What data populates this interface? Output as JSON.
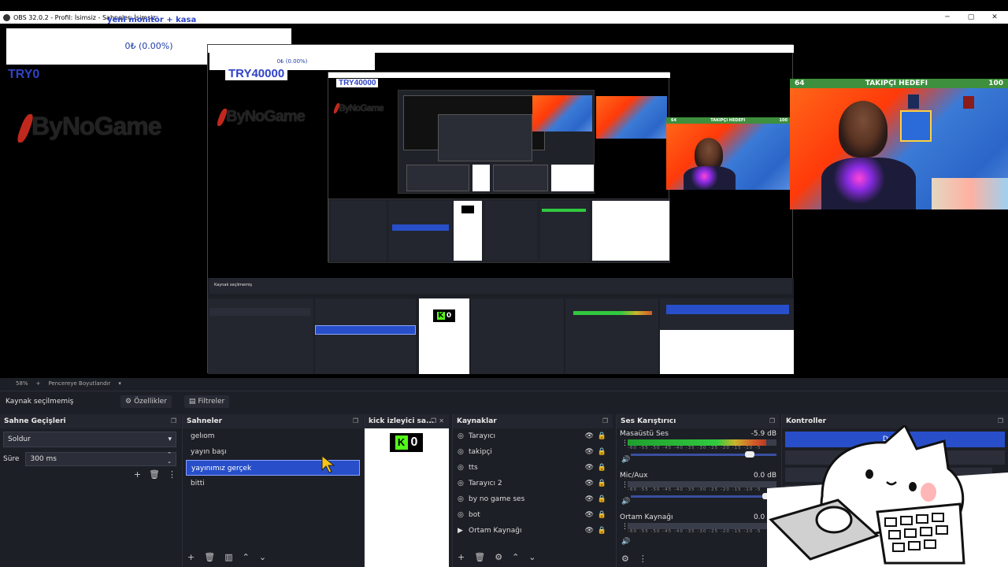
{
  "window": {
    "title": "OBS 32.0.2 - Profil: İsimsiz - Sahneler: İsimsiz",
    "overlay_text": "yeni monitör + kasa"
  },
  "preview": {
    "donation_text": "0₺ (0.00%)",
    "try_small": "TRY0",
    "try_big": "TRY40000",
    "try_mid": "TRY40000",
    "logo_text": "ByNoGame",
    "goal_label": "TAKIPÇI HEDEFI",
    "goal_current": "64",
    "goal_target": "100"
  },
  "status": {
    "zoom": "58%",
    "fit": "Pencereye Boyutlandır"
  },
  "source_bar": {
    "selected": "Kaynak seçilmemiş",
    "properties": "Özellikler",
    "filters": "Filtreler"
  },
  "transitions": {
    "title": "Sahne Geçişleri",
    "type": "Soldur",
    "duration_label": "Süre",
    "duration_value": "300 ms"
  },
  "scenes": {
    "title": "Sahneler",
    "items": [
      "gelıom",
      "yayın başı",
      "yayınımız gerçek",
      "bitti"
    ],
    "selected_index": 2
  },
  "kick": {
    "title": "kick izleyici sa...",
    "letter": "K",
    "count": "0"
  },
  "sources": {
    "title": "Kaynaklar",
    "items": [
      "Tarayıcı",
      "takipçi",
      "tts",
      "Tarayıcı 2",
      "by no game ses",
      "bot",
      "Ortam Kaynağı"
    ]
  },
  "mixer": {
    "title": "Ses Karıştırıcı",
    "channels": [
      {
        "name": "Masaüstü Ses",
        "db": "-5.9 dB",
        "level": 0.93,
        "volume": 0.85
      },
      {
        "name": "Mic/Aux",
        "db": "0.0 dB",
        "level": 0.0,
        "volume": 0.97
      },
      {
        "name": "Ortam Kaynağı",
        "db": "0.0 dB",
        "level": 0.0,
        "volume": 0.97
      }
    ],
    "ticks": "-60 -55 -50 -45 -40 -35 -30 -25 -20 -15 -10 -5 0"
  },
  "controls": {
    "title": "Kontroller",
    "stop_label": "Durdur"
  },
  "colors": {
    "accent": "#284fc9",
    "panel": "#1d1f26",
    "kick_green": "#53fc18"
  }
}
